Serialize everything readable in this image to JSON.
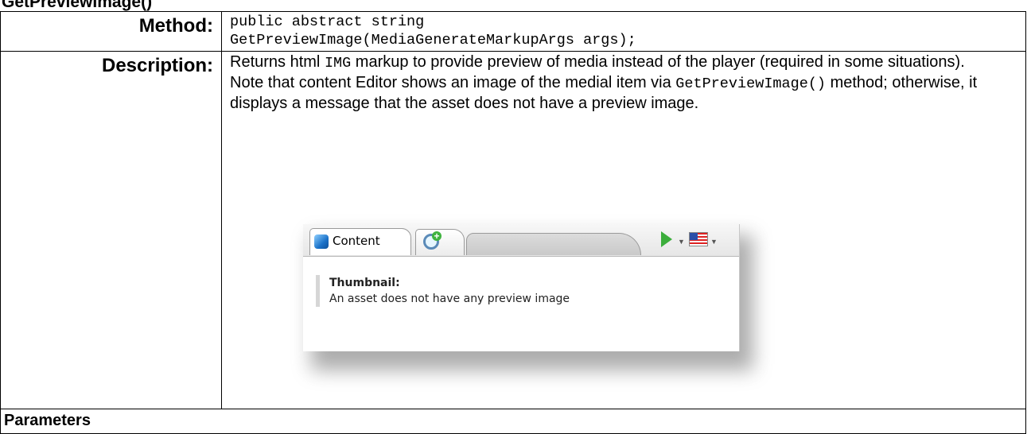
{
  "heading": "GetPreviewImage()",
  "method": {
    "label": "Method:",
    "signature_line1": "public abstract string",
    "signature_line2": "GetPreviewImage(MediaGenerateMarkupArgs args);"
  },
  "description": {
    "label": "Description:",
    "p1_before": "Returns html ",
    "p1_code": "IMG",
    "p1_after": " markup to provide preview of media instead of the player (required in some situations).",
    "p2_before": "Note that content Editor shows an image of the medial item via ",
    "p2_code": "GetPreviewImage()",
    "p2_after": "  method; otherwise, it displays a message that the asset does not have a preview image."
  },
  "screenshot": {
    "tab_content_label": "Content",
    "icons": [
      "cube-icon",
      "magnifier-add-icon",
      "navigate-icon",
      "flag-us-icon"
    ],
    "thumbnail_title": "Thumbnail:",
    "thumbnail_message": "An asset does not have any preview image"
  },
  "parameters_label": "Parameters"
}
